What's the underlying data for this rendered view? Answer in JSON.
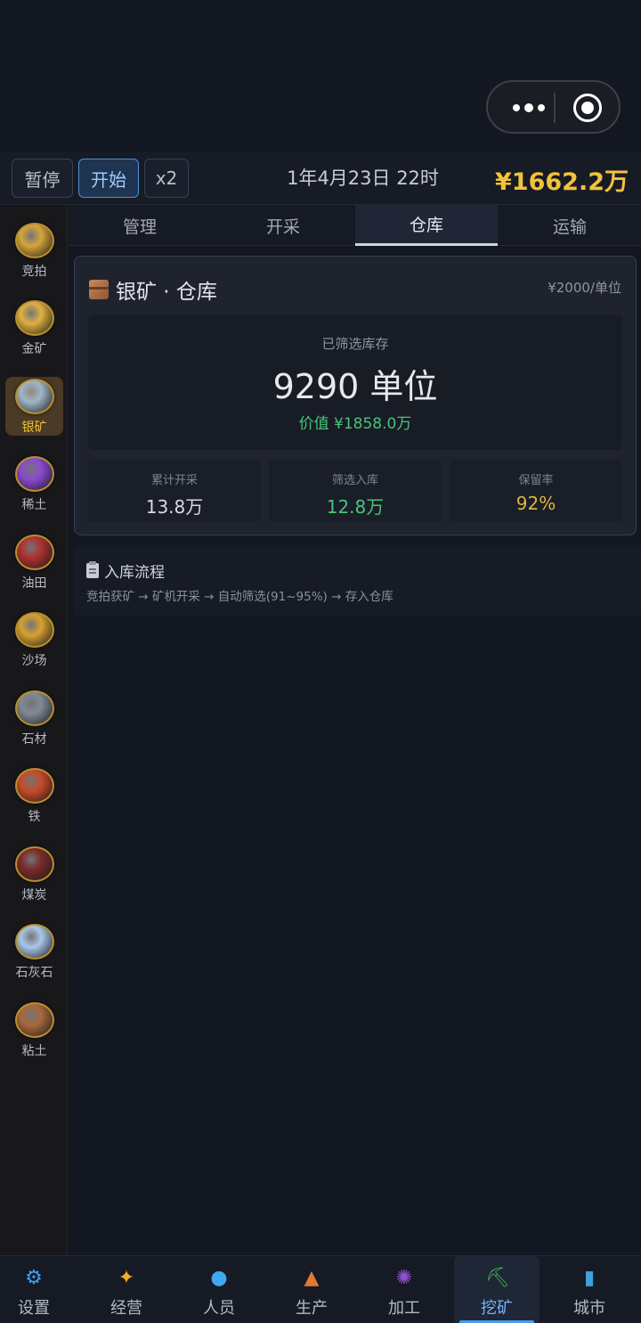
{
  "controls": {
    "pause_label": "暂停",
    "start_label": "开始",
    "speed_label": "x2",
    "game_time": "1年4月23日 22时",
    "money": "¥1662.2万"
  },
  "sidebar": {
    "items": [
      {
        "label": "竞拍",
        "icon": "auction-icon",
        "color": "#d6a53a"
      },
      {
        "label": "金矿",
        "icon": "gold-mine-icon",
        "color": "#e0b040"
      },
      {
        "label": "银矿",
        "icon": "silver-mine-icon",
        "color": "#9fb6c8"
      },
      {
        "label": "稀土",
        "icon": "rare-earth-icon",
        "color": "#8a4ad0"
      },
      {
        "label": "油田",
        "icon": "oil-field-icon",
        "color": "#b03030"
      },
      {
        "label": "沙场",
        "icon": "sand-field-icon",
        "color": "#d8a030"
      },
      {
        "label": "石材",
        "icon": "stone-icon",
        "color": "#7f8a96"
      },
      {
        "label": "铁",
        "icon": "iron-icon",
        "color": "#c84a2a"
      },
      {
        "label": "煤炭",
        "icon": "coal-icon",
        "color": "#7a2a2a"
      },
      {
        "label": "石灰石",
        "icon": "limestone-icon",
        "color": "#a8c8e8"
      },
      {
        "label": "粘土",
        "icon": "clay-icon",
        "color": "#a8683a"
      }
    ],
    "active_index": 2
  },
  "tabs": [
    {
      "label": "管理"
    },
    {
      "label": "开采"
    },
    {
      "label": "仓库"
    },
    {
      "label": "运输"
    }
  ],
  "active_tab": 2,
  "warehouse": {
    "title": "银矿 · 仓库",
    "price": "¥2000/单位",
    "stock_label": "已筛选库存",
    "stock_value": "9290 单位",
    "stock_worth": "价值 ¥1858.0万",
    "stats": [
      {
        "label": "累计开采",
        "value": "13.8万"
      },
      {
        "label": "筛选入库",
        "value": "12.8万"
      },
      {
        "label": "保留率",
        "value": "92%"
      }
    ]
  },
  "flow": {
    "title": "入库流程",
    "text": "竞拍获矿 → 矿机开采 → 自动筛选(91~95%) → 存入仓库"
  },
  "bottom_nav": [
    {
      "label": "设置",
      "icon": "gear-icon",
      "color": "#3ea0f0"
    },
    {
      "label": "经营",
      "icon": "business-icon",
      "color": "#f0b020"
    },
    {
      "label": "人员",
      "icon": "people-icon",
      "color": "#40a8f0"
    },
    {
      "label": "生产",
      "icon": "factory-icon",
      "color": "#e07a30"
    },
    {
      "label": "加工",
      "icon": "processing-icon",
      "color": "#9050d0"
    },
    {
      "label": "挖矿",
      "icon": "pickaxe-icon",
      "color": "#40b050"
    },
    {
      "label": "城市",
      "icon": "city-icon",
      "color": "#3aa0e0"
    }
  ],
  "active_nav": 5
}
